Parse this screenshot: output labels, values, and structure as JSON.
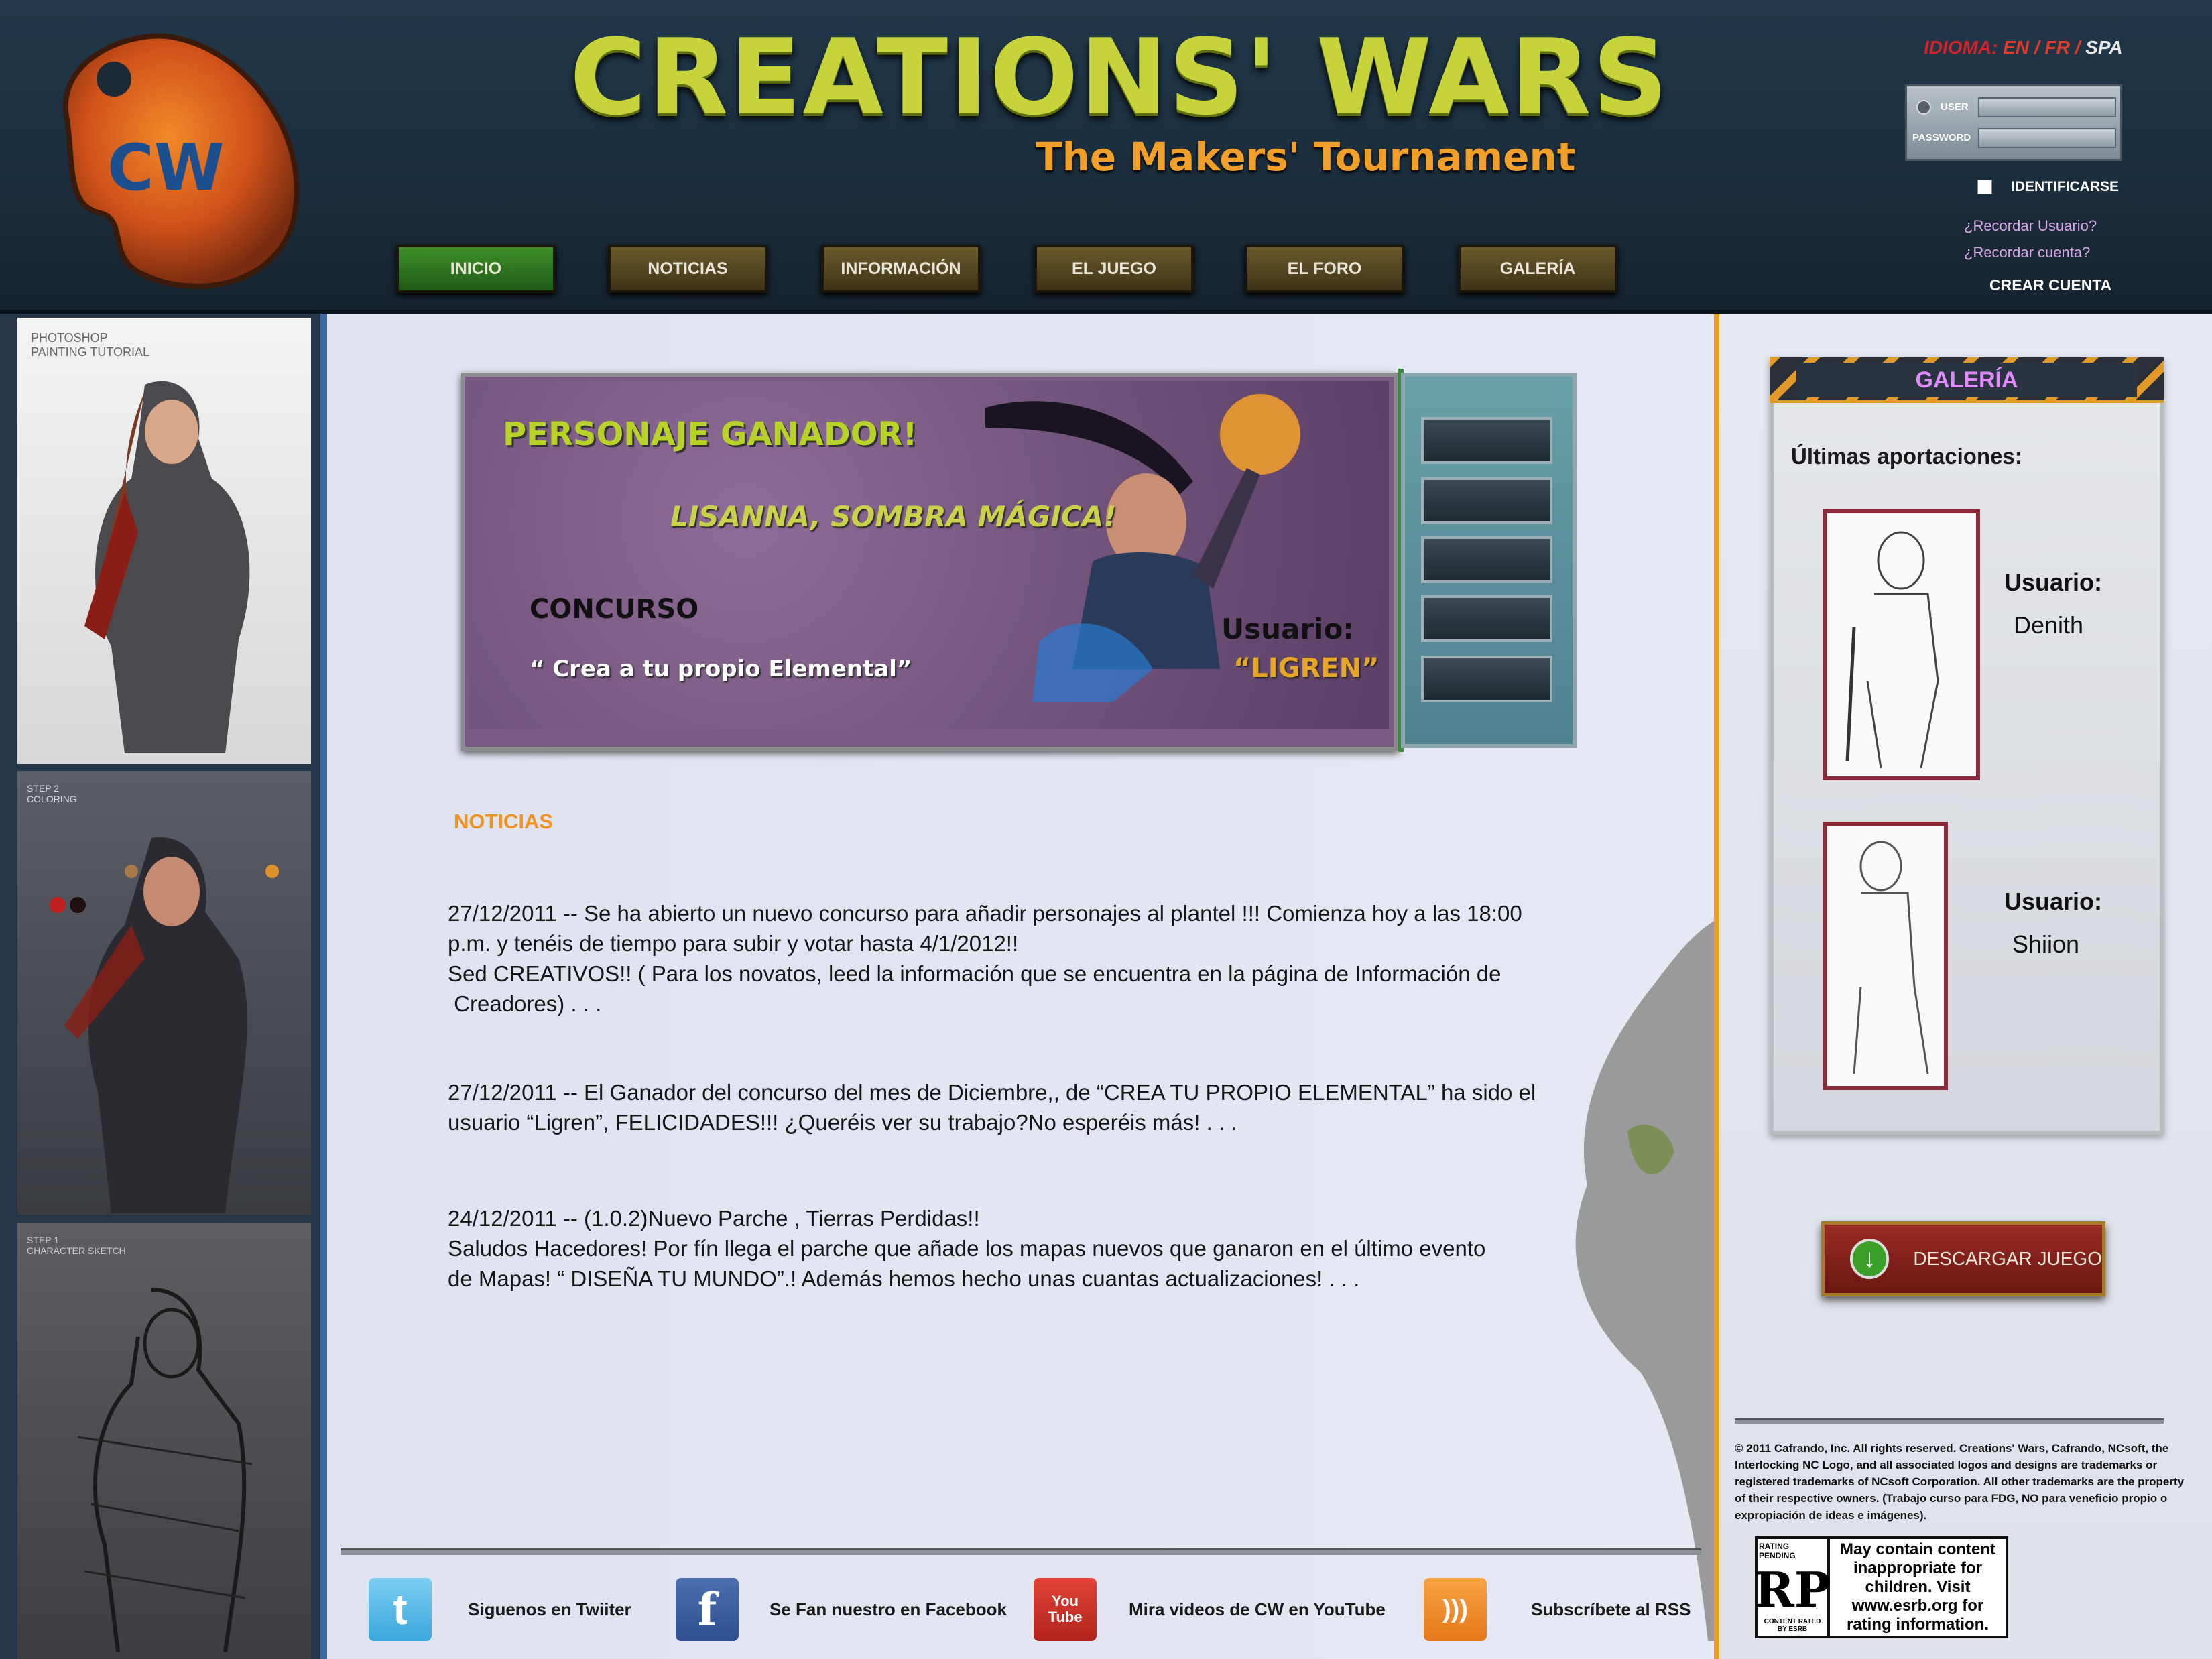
{
  "header": {
    "title": "CREATIONS' WARS",
    "subtitle": "The Makers' Tournament",
    "logo_text": "CW",
    "language": {
      "label": "IDIOMA:",
      "options": [
        "EN",
        "FR"
      ],
      "current": "SPA",
      "sep": "/"
    },
    "login": {
      "user_label": "USER",
      "password_label": "PASSWORD",
      "identify": "IDENTIFICARSE",
      "recover_user": "¿Recordar Usuario?",
      "recover_account": "¿Recordar cuenta?",
      "create": "CREAR CUENTA"
    },
    "nav": [
      {
        "label": "INICIO",
        "active": true
      },
      {
        "label": "NOTICIAS"
      },
      {
        "label": "INFORMACIÓN"
      },
      {
        "label": "EL JUEGO"
      },
      {
        "label": "EL FORO"
      },
      {
        "label": "GALERÍA"
      }
    ]
  },
  "left_art": {
    "caption1": "PHOTOSHOP\nPAINTING TUTORIAL",
    "caption2": "STEP 2\nCOLORING",
    "caption3": "STEP 1\nCHARACTER SKETCH"
  },
  "banner": {
    "heading": "PERSONAJE GANADOR!",
    "character": "LISANNA, SOMBRA MÁGICA!",
    "contest_label": "CONCURSO",
    "contest_name": "“ Crea a tu propio Elemental”",
    "user_label": "Usuario:",
    "user_name": "“LIGREN”"
  },
  "news": {
    "heading": "NOTICIAS",
    "items": [
      {
        "lines": [
          "27/12/2011 -- Se ha abierto un nuevo concurso para añadir personajes al plantel !!! Comienza hoy a las 18:00",
          "p.m. y  tenéis de tiempo para subir y votar hasta 4/1/2012!!",
          "Sed  CREATIVOS!! ( Para los novatos, leed la información que se encuentra en la página de Información de",
          " Creadores) . . ."
        ]
      },
      {
        "lines": [
          "27/12/2011 -- El Ganador del concurso del mes de Diciembre,, de  “CREA TU PROPIO ELEMENTAL” ha sido el",
          "usuario “Ligren”, FELICIDADES!!! ¿Queréis ver su trabajo?No esperéis más! . . ."
        ]
      },
      {
        "lines": [
          "24/12/2011 -- (1.0.2)Nuevo Parche , Tierras Perdidas!!",
          "Saludos Hacedores! Por fín llega el parche que añade los  mapas nuevos que ganaron en el último evento",
          "de  Mapas! “ DISEÑA TU MUNDO”.!  Además hemos hecho unas cuantas actualizaciones! . . ."
        ]
      }
    ]
  },
  "social": [
    {
      "icon": "twitter-icon",
      "glyph": "t",
      "text": "Siguenos en Twiiter",
      "color": "#3aa7dd"
    },
    {
      "icon": "facebook-icon",
      "glyph": "f",
      "text": "Se Fan nuestro en Facebook",
      "color": "#2f4f8f"
    },
    {
      "icon": "youtube-icon",
      "glyph": "You\nTube",
      "text": "Mira videos de CW en YouTube",
      "color": "#c42a22"
    },
    {
      "icon": "rss-icon",
      "glyph": ")))",
      "text": "Subscríbete al RSS",
      "color": "#f08a1e"
    }
  ],
  "gallery": {
    "title": "GALERÍA",
    "subtitle": "Últimas aportaciones:",
    "items": [
      {
        "label": "Usuario:",
        "user": "Denith"
      },
      {
        "label": "Usuario:",
        "user": "Shiion"
      }
    ]
  },
  "download": {
    "label": "DESCARGAR JUEGO"
  },
  "copyright": "© 2011 Cafrando, Inc. All rights reserved. Creations' Wars, Cafrando, NCsoft, the Interlocking NC Logo, and all associated logos and designs are trademarks or registered trademarks of NCsoft Corporation. All other trademarks are the property of their respective owners. (Trabajo curso para FDG, NO para veneficio propio o expropiación de ideas e imágenes).",
  "esrb": {
    "top": "RATING PENDING",
    "rp": "RP",
    "bottom": "CONTENT RATED BY ESRB",
    "text": "May contain content inappropriate for children. Visit www.esrb.org for rating information."
  }
}
